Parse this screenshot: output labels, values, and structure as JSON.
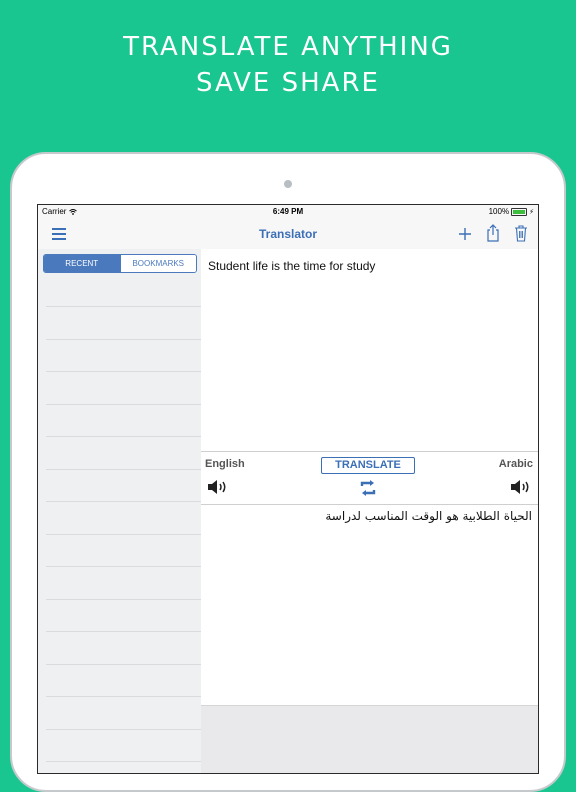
{
  "promo": {
    "line1": "TRANSLATE ANYTHING",
    "line2": "SAVE SHARE",
    "background_color": "#19c68f"
  },
  "status_bar": {
    "carrier": "Carrier",
    "time": "6:49 PM",
    "battery": "100%"
  },
  "nav": {
    "title": "Translator",
    "left_icon": "menu-icon",
    "right_icons": [
      "plus-icon",
      "share-icon",
      "trash-icon"
    ],
    "accent_color": "#3b6fb6"
  },
  "sidebar": {
    "tabs": [
      {
        "label": "RECENT",
        "selected": true
      },
      {
        "label": "BOOKMARKS",
        "selected": false
      }
    ]
  },
  "translator": {
    "source_text": "Student life is the time for study",
    "source_language": "English",
    "target_language": "Arabic",
    "translate_label": "TRANSLATE",
    "target_text": "الحياة الطلابية هو الوقت المناسب لدراسة"
  }
}
